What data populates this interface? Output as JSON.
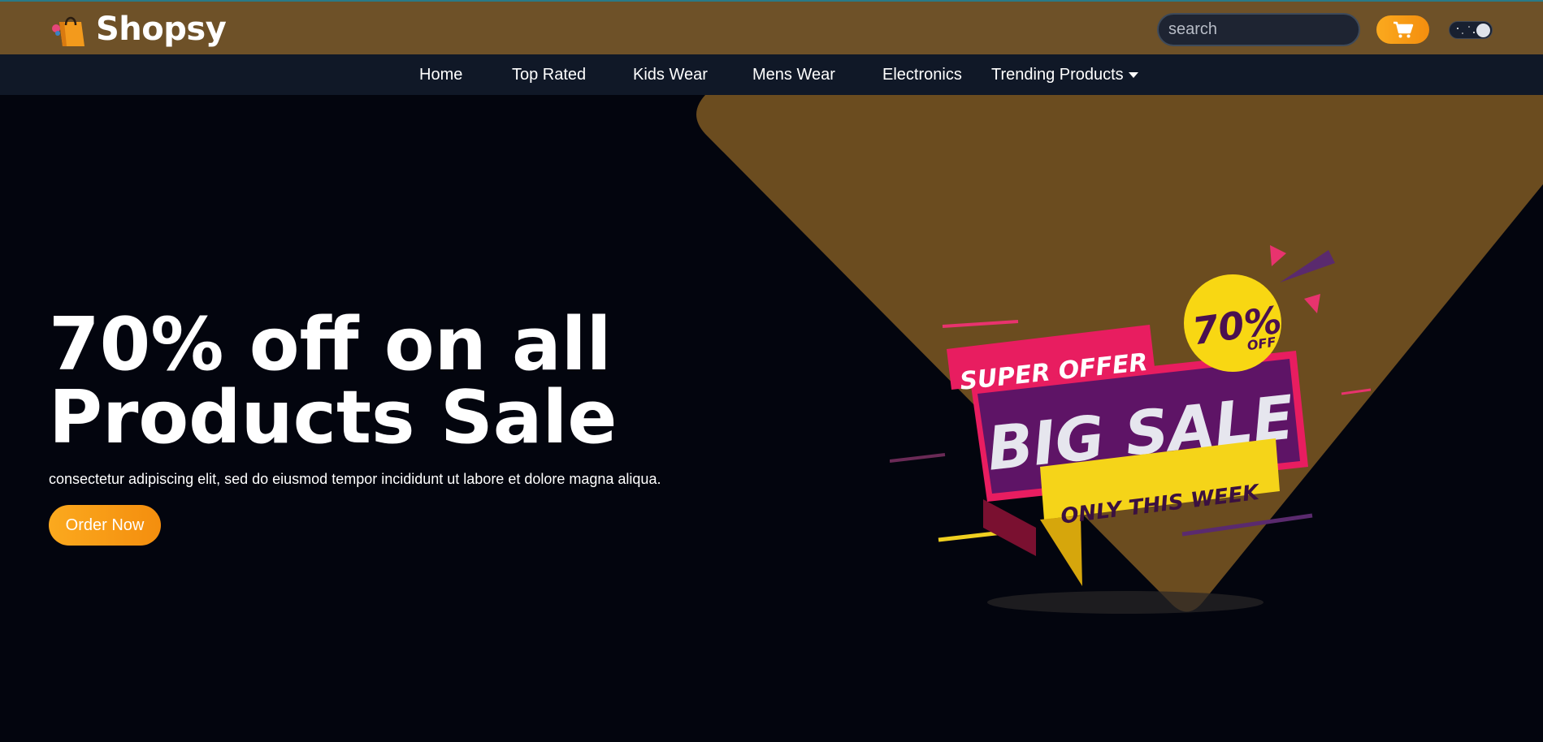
{
  "brand": {
    "name": "Shopsy"
  },
  "header": {
    "search_placeholder": "search",
    "accent_color": "#f6a01a",
    "bar_color": "#6e5128"
  },
  "nav": {
    "items": [
      {
        "label": "Home"
      },
      {
        "label": "Top Rated"
      },
      {
        "label": "Kids Wear"
      },
      {
        "label": "Mens Wear"
      },
      {
        "label": "Electronics"
      },
      {
        "label": "Trending Products"
      }
    ]
  },
  "hero": {
    "title_line1": "70% off on all",
    "title_line2": "Products Sale",
    "subtitle": "consectetur adipiscing elit, sed do eiusmod tempor incididunt ut labore et dolore magna aliqua.",
    "cta_label": "Order Now"
  },
  "promo_badge": {
    "top_label": "SUPER OFFER",
    "main_label": "BIG SALE",
    "ribbon_label": "ONLY THIS WEEK",
    "discount": "70%",
    "discount_suffix": "OFF"
  }
}
